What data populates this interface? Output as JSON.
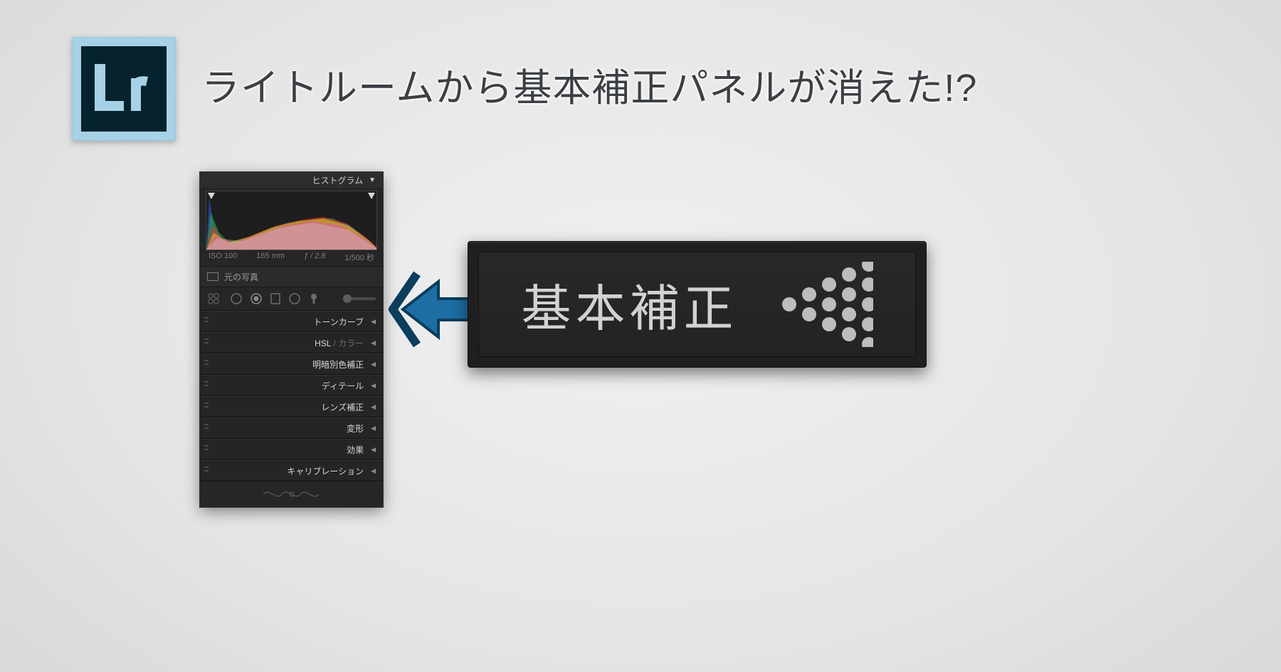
{
  "icon": {
    "text": "Lr"
  },
  "headline": "ライトルームから基本補正パネルが消えた!?",
  "panel": {
    "histogram_label": "ヒストグラム",
    "info": {
      "iso": "ISO 100",
      "focal": "165 mm",
      "aperture": "ƒ / 2.8",
      "shutter": "1/500 秒"
    },
    "original_label": "元の写真",
    "sections": [
      {
        "label": "トーンカーブ"
      },
      {
        "label_pre": "HSL",
        "label_dim": " / カラー"
      },
      {
        "label": "明暗別色補正"
      },
      {
        "label": "ディテール"
      },
      {
        "label": "レンズ補正"
      },
      {
        "label": "変形"
      },
      {
        "label": "効果"
      },
      {
        "label": "キャリブレーション"
      }
    ]
  },
  "card": {
    "label": "基本補正"
  },
  "colors": {
    "arrow": "#1d6ea3",
    "arrow_border": "#0b3d5c"
  }
}
